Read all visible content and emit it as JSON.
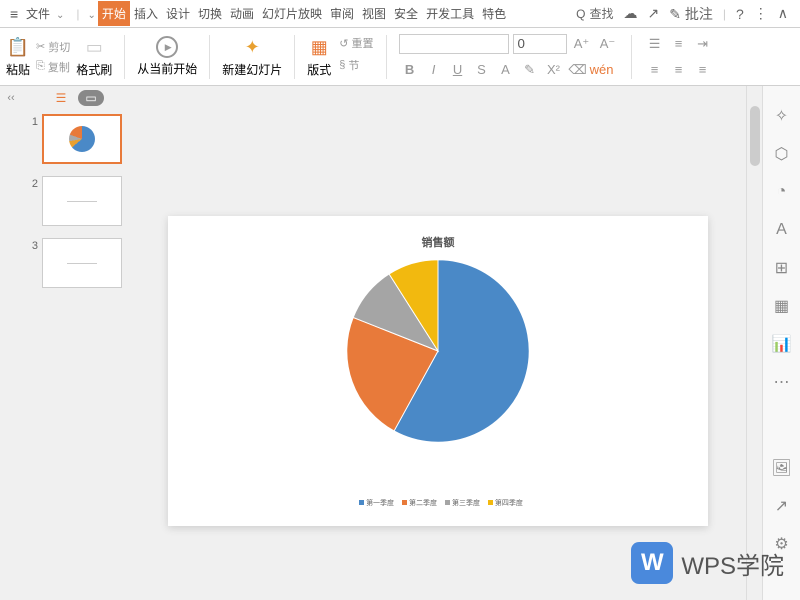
{
  "menu": {
    "file": "文件",
    "tabs": [
      "开始",
      "插入",
      "设计",
      "切换",
      "动画",
      "幻灯片放映",
      "审阅",
      "视图",
      "安全",
      "开发工具",
      "特色"
    ],
    "active_tab": 0,
    "search": "查找",
    "annotate": "批注"
  },
  "ribbon": {
    "paste": "粘贴",
    "cut": "剪切",
    "copy": "复制",
    "format_painter": "格式刷",
    "from_current": "从当前开始",
    "new_slide": "新建幻灯片",
    "layout": "版式",
    "section": "节",
    "reset": "重置",
    "font_size": "0"
  },
  "slides": [
    {
      "num": "1",
      "type": "pie"
    },
    {
      "num": "2",
      "type": "blank"
    },
    {
      "num": "3",
      "type": "blank"
    }
  ],
  "chart_data": {
    "type": "pie",
    "title": "销售额",
    "categories": [
      "第一季度",
      "第二季度",
      "第三季度",
      "第四季度"
    ],
    "values": [
      58,
      23,
      10,
      9
    ],
    "colors": [
      "#4a89c7",
      "#e87a3a",
      "#a5a5a5",
      "#f2b90f"
    ],
    "legend_prefix": "■"
  },
  "watermark": {
    "logo": "W",
    "text": "WPS学院"
  }
}
